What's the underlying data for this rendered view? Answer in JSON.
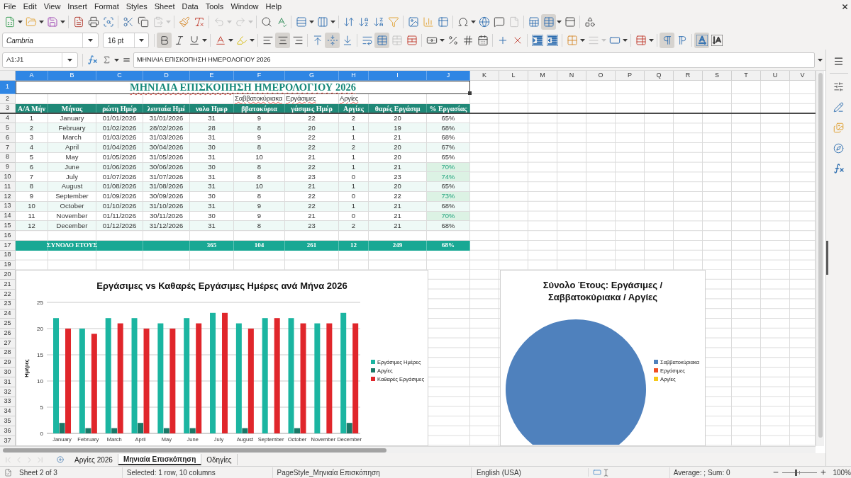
{
  "menu_bar": {
    "items": [
      "File",
      "Edit",
      "View",
      "Insert",
      "Format",
      "Styles",
      "Sheet",
      "Data",
      "Tools",
      "Window",
      "Help"
    ]
  },
  "standard_bar": {
    "paste": {
      "disabled": true
    },
    "undo": {
      "disabled": true
    },
    "redo": {
      "disabled": true
    },
    "headers_footers": {
      "disabled": true
    },
    "freeze": {
      "on": true
    }
  },
  "format_bar": {
    "font_name": "Cambria",
    "font_size": "16 pt",
    "bold": {
      "on": true
    },
    "italic": {
      "on": false
    },
    "underline": {
      "on": false
    },
    "align_left": {
      "selected": false
    },
    "align_center": {
      "selected": true
    },
    "align_right": {
      "selected": false
    },
    "align_top": {
      "selected": false
    },
    "align_middle": {
      "selected": true
    },
    "align_bottom": {
      "selected": false
    },
    "wrap": {
      "on": false
    },
    "merge_center": {
      "on": true
    },
    "merge": {
      "disabled": true
    },
    "border_style": {
      "disabled": true
    },
    "ltr": {
      "selected": true
    },
    "rtl": {
      "selected": false
    },
    "text_horizontal": {
      "selected": true
    },
    "text_vertical": {
      "selected": false
    }
  },
  "formula_bar": {
    "name_box": "A1:J1",
    "formula": "ΜΗΝΙΑΙΑ ΕΠΙΣΚΟΠΗΣΗ ΗΜΕΡΟΛΟΓΙΟΥ 2026"
  },
  "sheet": {
    "columns": [
      {
        "label": "A",
        "selected": true
      },
      {
        "label": "B",
        "selected": true
      },
      {
        "label": "C",
        "selected": true
      },
      {
        "label": "D",
        "selected": true
      },
      {
        "label": "E",
        "selected": true
      },
      {
        "label": "F",
        "selected": true
      },
      {
        "label": "G",
        "selected": true
      },
      {
        "label": "H",
        "selected": true
      },
      {
        "label": "I",
        "selected": true
      },
      {
        "label": "J",
        "selected": true
      },
      {
        "label": "K",
        "selected": false
      },
      {
        "label": "L",
        "selected": false
      },
      {
        "label": "M",
        "selected": false
      },
      {
        "label": "N",
        "selected": false
      },
      {
        "label": "O",
        "selected": false
      },
      {
        "label": "P",
        "selected": false
      },
      {
        "label": "Q",
        "selected": false
      },
      {
        "label": "R",
        "selected": false
      },
      {
        "label": "S",
        "selected": false
      },
      {
        "label": "T",
        "selected": false
      },
      {
        "label": "U",
        "selected": false
      },
      {
        "label": "V",
        "selected": false
      }
    ],
    "rows": [
      {
        "label": "1",
        "selected": true,
        "kind": "title",
        "text": "ΜΗΝΙΑΙΑ ΕΠΙΣΚΟΠΗΣΗ ΗΜΕΡΟΛΟΓΙΟΥ 2026"
      },
      {
        "label": "2",
        "selected": false,
        "kind": "labels",
        "cells": [
          null,
          null,
          null,
          null,
          null,
          "Σαββατοκύριακα",
          "Εργάσιμες",
          "Αργίες",
          null,
          null
        ]
      },
      {
        "label": "3",
        "selected": false,
        "kind": "header",
        "cells": [
          "Α/Α Μήν",
          "Μήνας",
          "ρώτη Ημέρ",
          "λευταία Ημέ",
          "νολο Ημερ",
          "ββατοκύρια",
          "γάσιμες Ημέρ",
          "Αργίες",
          "θαρές Εργάσιμ",
          "% Εργασίας"
        ]
      },
      {
        "label": "4",
        "selected": false,
        "kind": "data",
        "highlight": false,
        "cells": [
          "1",
          "January",
          "01/01/2026",
          "31/01/2026",
          "31",
          "9",
          "22",
          "2",
          "20",
          "65%"
        ]
      },
      {
        "label": "5",
        "selected": false,
        "kind": "data",
        "highlight": false,
        "cells": [
          "2",
          "February",
          "01/02/2026",
          "28/02/2026",
          "28",
          "8",
          "20",
          "1",
          "19",
          "68%"
        ]
      },
      {
        "label": "6",
        "selected": false,
        "kind": "data",
        "highlight": false,
        "cells": [
          "3",
          "March",
          "01/03/2026",
          "31/03/2026",
          "31",
          "9",
          "22",
          "1",
          "21",
          "68%"
        ]
      },
      {
        "label": "7",
        "selected": false,
        "kind": "data",
        "highlight": false,
        "cells": [
          "4",
          "April",
          "01/04/2026",
          "30/04/2026",
          "30",
          "8",
          "22",
          "2",
          "20",
          "67%"
        ]
      },
      {
        "label": "8",
        "selected": false,
        "kind": "data",
        "highlight": false,
        "cells": [
          "5",
          "May",
          "01/05/2026",
          "31/05/2026",
          "31",
          "10",
          "21",
          "1",
          "20",
          "65%"
        ]
      },
      {
        "label": "9",
        "selected": false,
        "kind": "data",
        "highlight": true,
        "cells": [
          "6",
          "June",
          "01/06/2026",
          "30/06/2026",
          "30",
          "8",
          "22",
          "1",
          "21",
          "70%"
        ]
      },
      {
        "label": "10",
        "selected": false,
        "kind": "data",
        "highlight": true,
        "cells": [
          "7",
          "July",
          "01/07/2026",
          "31/07/2026",
          "31",
          "8",
          "23",
          "0",
          "23",
          "74%"
        ]
      },
      {
        "label": "11",
        "selected": false,
        "kind": "data",
        "highlight": false,
        "cells": [
          "8",
          "August",
          "01/08/2026",
          "31/08/2026",
          "31",
          "10",
          "21",
          "1",
          "20",
          "65%"
        ]
      },
      {
        "label": "12",
        "selected": false,
        "kind": "data",
        "highlight": true,
        "cells": [
          "9",
          "September",
          "01/09/2026",
          "30/09/2026",
          "30",
          "8",
          "22",
          "0",
          "22",
          "73%"
        ]
      },
      {
        "label": "13",
        "selected": false,
        "kind": "data",
        "highlight": false,
        "cells": [
          "10",
          "October",
          "01/10/2026",
          "31/10/2026",
          "31",
          "9",
          "22",
          "1",
          "21",
          "68%"
        ]
      },
      {
        "label": "14",
        "selected": false,
        "kind": "data",
        "highlight": true,
        "cells": [
          "11",
          "November",
          "01/11/2026",
          "30/11/2026",
          "30",
          "9",
          "21",
          "0",
          "21",
          "70%"
        ]
      },
      {
        "label": "15",
        "selected": false,
        "kind": "data",
        "highlight": false,
        "cells": [
          "12",
          "December",
          "01/12/2026",
          "31/12/2026",
          "31",
          "8",
          "23",
          "2",
          "21",
          "68%"
        ]
      },
      {
        "label": "16",
        "selected": false,
        "kind": "empty"
      },
      {
        "label": "17",
        "selected": false,
        "kind": "total",
        "cells": [
          null,
          "ΣΥΝΟΛΟ ΕΤΟΥΣ",
          null,
          null,
          "365",
          "104",
          "261",
          "12",
          "249",
          "68%"
        ]
      },
      {
        "label": "18",
        "selected": false,
        "kind": "empty"
      },
      {
        "label": "19",
        "selected": false,
        "kind": "empty"
      },
      {
        "label": "20",
        "selected": false,
        "kind": "empty"
      },
      {
        "label": "21",
        "selected": false,
        "kind": "empty"
      },
      {
        "label": "22",
        "selected": false,
        "kind": "empty"
      },
      {
        "label": "23",
        "selected": false,
        "kind": "empty"
      },
      {
        "label": "24",
        "selected": false,
        "kind": "empty"
      },
      {
        "label": "25",
        "selected": false,
        "kind": "empty"
      },
      {
        "label": "26",
        "selected": false,
        "kind": "empty"
      },
      {
        "label": "27",
        "selected": false,
        "kind": "empty"
      },
      {
        "label": "28",
        "selected": false,
        "kind": "empty"
      },
      {
        "label": "29",
        "selected": false,
        "kind": "empty"
      },
      {
        "label": "30",
        "selected": false,
        "kind": "empty"
      },
      {
        "label": "31",
        "selected": false,
        "kind": "empty"
      },
      {
        "label": "32",
        "selected": false,
        "kind": "empty"
      },
      {
        "label": "33",
        "selected": false,
        "kind": "empty"
      },
      {
        "label": "34",
        "selected": false,
        "kind": "empty"
      },
      {
        "label": "35",
        "selected": false,
        "kind": "empty"
      },
      {
        "label": "36",
        "selected": false,
        "kind": "empty"
      },
      {
        "label": "37",
        "selected": false,
        "kind": "empty"
      }
    ],
    "charts": [
      {
        "chart_data": {
          "type": "bar",
          "title": "Εργάσιμες vs Καθαρές Εργάσιμες Ημέρες ανά Μήνα 2026",
          "ylabel": "Ημέρες",
          "categories": [
            "January",
            "February",
            "March",
            "April",
            "May",
            "June",
            "July",
            "August",
            "September",
            "October",
            "November",
            "December"
          ],
          "series": [
            {
              "name": "Εργάσιμες Ημέρες",
              "color": "#1bb5a1",
              "values": [
                22,
                20,
                22,
                22,
                21,
                22,
                23,
                21,
                22,
                22,
                21,
                23
              ]
            },
            {
              "name": "Αργίες",
              "color": "#1a7867",
              "values": [
                2,
                1,
                1,
                2,
                1,
                1,
                0,
                1,
                0,
                1,
                0,
                2
              ]
            },
            {
              "name": "Καθαρές Εργάσιμες",
              "color": "#e0262b",
              "values": [
                20,
                19,
                21,
                20,
                20,
                21,
                23,
                20,
                22,
                21,
                21,
                21
              ]
            }
          ],
          "ylim": [
            0,
            25
          ],
          "yticks": [
            0,
            5,
            10,
            15,
            20,
            25
          ],
          "grid": true,
          "legend": "right"
        }
      },
      {
        "chart_data": {
          "type": "pie",
          "title": "Σύνολο Έτους: Εργάσιμες / Σαββατοκύριακα / Αργίες",
          "categories": [
            "Σαββατοκύριακα",
            "Εργάσιμες",
            "Αργίες"
          ],
          "values": [
            1,
            0,
            0
          ],
          "colors": [
            "#4f81bd",
            "#f04e23",
            "#f6c918"
          ],
          "legend": "right"
        }
      }
    ]
  },
  "sheet_tabs": {
    "navigation": {
      "disabled": true
    },
    "tabs": [
      {
        "label": "Αργίες 2026",
        "selected": false
      },
      {
        "label": "Μηνιαία Επισκόπηση",
        "selected": true
      },
      {
        "label": "Οδηγίες",
        "selected": false
      }
    ]
  },
  "status_bar": {
    "sheet": "Sheet 2 of 3",
    "selection": "Selected: 1 row, 10 columns",
    "page_style": "PageStyle_Μηνιαία Επισκόπηση",
    "language": "English (USA)",
    "summary": "Average: ; Sum: 0",
    "zoom": {
      "value": "100%",
      "level": 0.4
    }
  }
}
